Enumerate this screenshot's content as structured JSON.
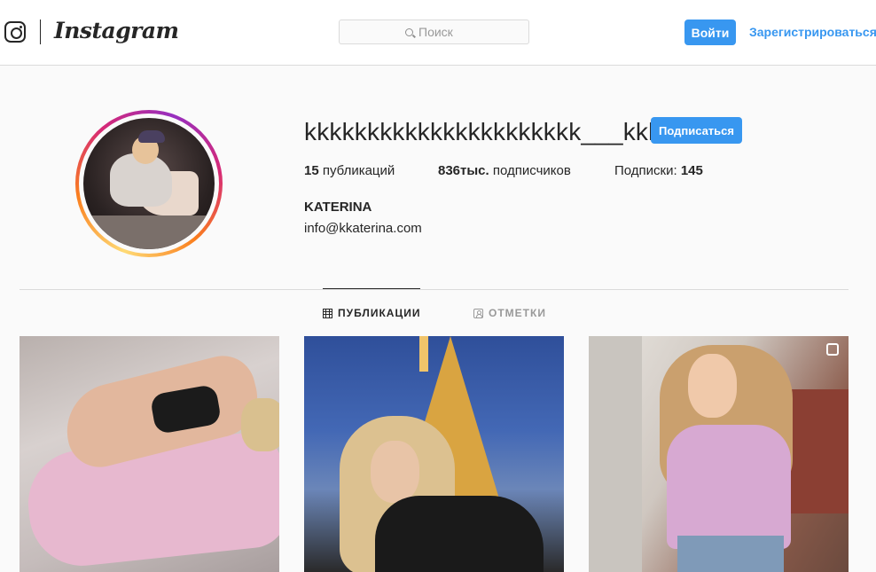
{
  "header": {
    "wordmark": "Instagram",
    "search_placeholder": "Поиск",
    "login_label": "Войти",
    "signup_label": "Зарегистрироваться"
  },
  "profile": {
    "username": "kkkkkkkkkkkkkkkkkkkkkk___kkkk",
    "follow_label": "Подписаться",
    "posts_count": "15",
    "posts_label": " публикаций",
    "followers_count": "836тыс.",
    "followers_label": " подписчиков",
    "following_label": "Подписки: ",
    "following_count": "145",
    "full_name": "KATERINA",
    "bio": "info@kkaterina.com"
  },
  "tabs": [
    {
      "label": "ПУБЛИКАЦИИ",
      "icon": "grid-icon",
      "active": true
    },
    {
      "label": "ОТМЕТКИ",
      "icon": "tag-icon",
      "active": false
    }
  ],
  "colors": {
    "accent": "#3897f0",
    "text": "#262626",
    "muted": "#999999",
    "border": "#dbdbdb",
    "background": "#fafafa"
  }
}
